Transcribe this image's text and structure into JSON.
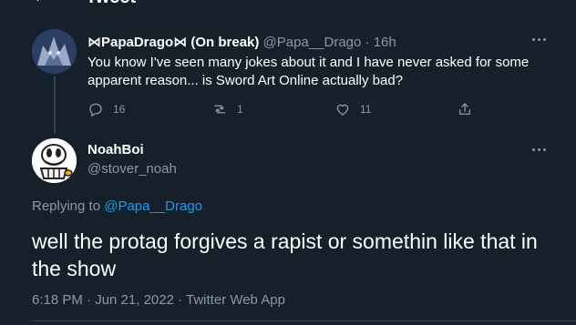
{
  "header": {
    "title": "Tweet"
  },
  "parent_tweet": {
    "display_name": "⋈PapaDrago⋈ (On break)",
    "handle": "@Papa__Drago",
    "separator": "·",
    "time": "16h",
    "text": "You know I've seen many jokes about it and I have never asked for some apparent reason... is Sword Art Online actually bad?",
    "replies": "16",
    "retweets": "1",
    "likes": "11"
  },
  "reply_tweet": {
    "display_name": "NoahBoi",
    "handle": "@stover_noah",
    "replying_prefix": "Replying to",
    "replying_to": "@Papa__Drago",
    "text": "well the protag forgives a rapist or somethin like that in the show",
    "timestamp": "6:18 PM · Jun 21, 2022 · Twitter Web App"
  },
  "icons": {
    "back": "back-arrow-icon",
    "more": "more-icon",
    "reply": "reply-icon",
    "retweet": "retweet-icon",
    "like": "heart-icon",
    "share": "share-icon"
  },
  "colors": {
    "background": "#15202b",
    "text": "#ffffff",
    "secondary": "#8b98a5",
    "link": "#1d9bf0",
    "border": "#38444d"
  }
}
